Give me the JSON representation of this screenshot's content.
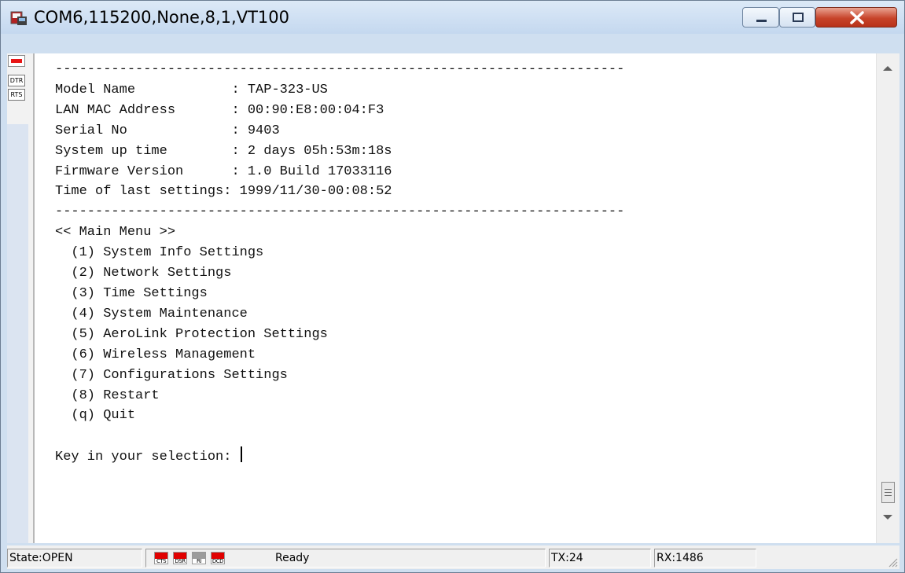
{
  "window": {
    "title": "COM6,115200,None,8,1,VT100",
    "controls": [
      "minimize-icon",
      "maximize-icon",
      "close-icon"
    ]
  },
  "sidebar": {
    "dtr_label": "DTR",
    "rts_label": "RTS"
  },
  "terminal": {
    "separator": "-----------------------------------------------------------------------",
    "info": [
      {
        "label": "Model Name",
        "value": "TAP-323-US"
      },
      {
        "label": "LAN MAC Address",
        "value": "00:90:E8:00:04:F3"
      },
      {
        "label": "Serial No",
        "value": "9403"
      },
      {
        "label": "System up time",
        "value": "2 days 05h:53m:18s"
      },
      {
        "label": "Firmware Version",
        "value": "1.0 Build 17033116"
      },
      {
        "label": "Time of last settings",
        "value": "1999/11/30-00:08:52"
      }
    ],
    "menu_title": "<< Main Menu >>",
    "menu_items": [
      "(1) System Info Settings",
      "(2) Network Settings",
      "(3) Time Settings",
      "(4) System Maintenance",
      "(5) AeroLink Protection Settings",
      "(6) Wireless Management",
      "(7) Configurations Settings",
      "(8) Restart",
      "(q) Quit"
    ],
    "prompt": "Key in your selection: "
  },
  "status": {
    "state": "State:OPEN",
    "signals": [
      "CTS",
      "DSR",
      "RI",
      "DCD"
    ],
    "ready": "Ready",
    "tx": "TX:24",
    "rx": "RX:1486"
  }
}
